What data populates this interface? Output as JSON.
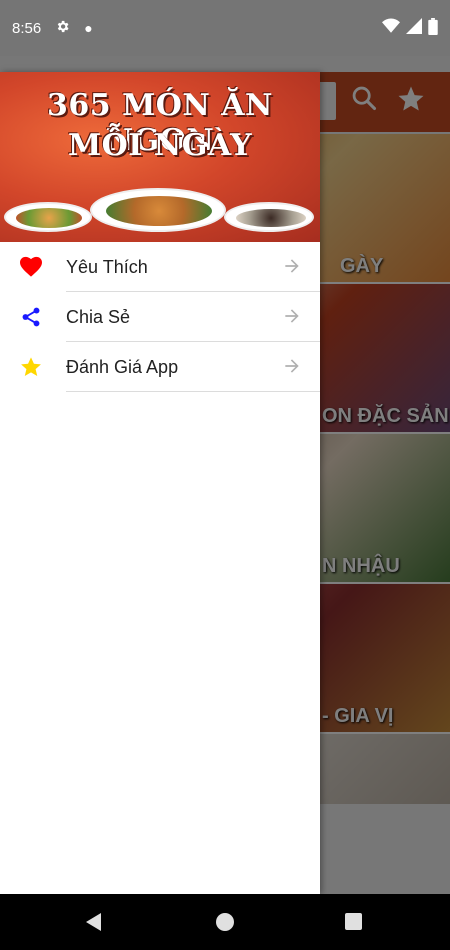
{
  "status_bar": {
    "time": "8:56",
    "icons": [
      "gear-icon",
      "notification-dot-icon",
      "wifi-icon",
      "signal-icon",
      "battery-icon"
    ]
  },
  "app": {
    "toolbar": {
      "color": "#c44a22",
      "icons": [
        "search-icon",
        "star-icon"
      ]
    },
    "cards": [
      {
        "caption": "GÀY"
      },
      {
        "caption": "ON ĐẶC SẢN"
      },
      {
        "caption": "N NHẬU"
      },
      {
        "caption": "- GIA VỊ"
      }
    ]
  },
  "drawer": {
    "header": {
      "title_line1": "365 MÓN ĂN NGON",
      "title_line2": "MỖI NGÀY"
    },
    "items": [
      {
        "label": "Yêu Thích",
        "icon": "heart-icon",
        "icon_color": "#ff0000"
      },
      {
        "label": "Chia Sẻ",
        "icon": "share-icon",
        "icon_color": "#1a1aff"
      },
      {
        "label": "Đánh Giá App",
        "icon": "star-icon",
        "icon_color": "#ffd700"
      }
    ]
  },
  "nav_bar": {
    "buttons": [
      "back-icon",
      "home-icon",
      "recents-icon"
    ]
  }
}
